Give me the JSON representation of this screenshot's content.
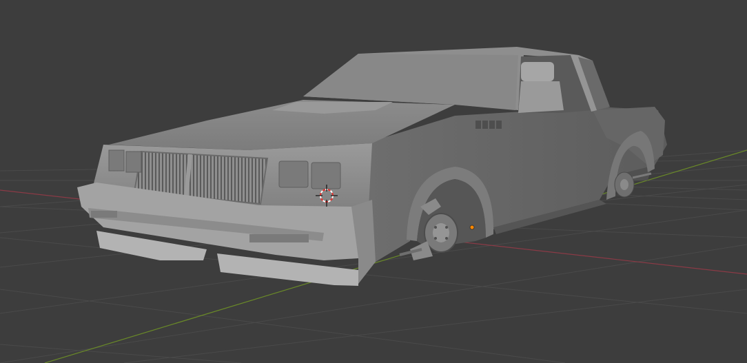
{
  "viewport": {
    "background_color": "#3d3d3d",
    "grid_color": "#484848",
    "axis_x_color": "#8b3a46",
    "axis_y_color": "#6a8a28",
    "cursor_icon": "3d-cursor-icon",
    "origin_color": "#ff8800"
  },
  "scene": {
    "object_kind": "car-body-mesh",
    "shading": "solid",
    "body_color": "#8a8a8a"
  }
}
